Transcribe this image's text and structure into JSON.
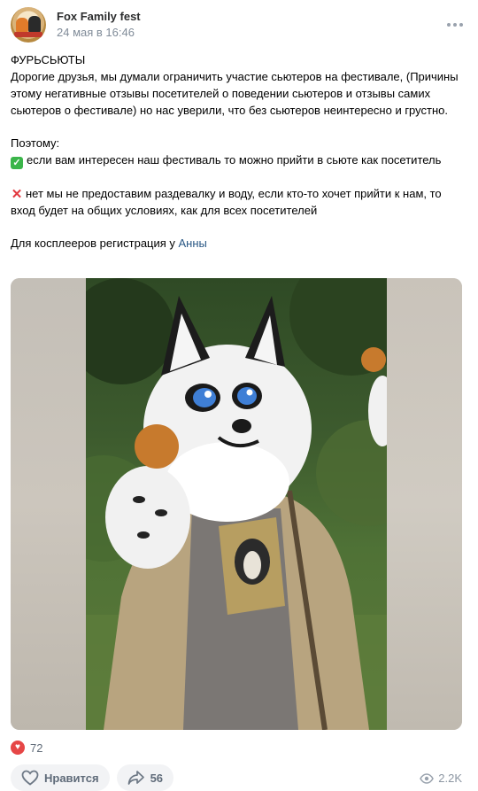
{
  "post": {
    "author": "Fox Family fest",
    "date": "24 мая в 16:46",
    "text": {
      "title": "ФУРЬСЬЮТЫ",
      "para1": "Дорогие друзья, мы думали ограничить участие сьютеров на фестивале, (Причины этому негативные отзывы посетителей о поведении сьютеров и отзывы самих сьютеров о фестивале) но нас уверили, что без сьютеров неинтересно и грустно.",
      "therefore": "Поэтому:",
      "yes_line": "если вам интересен наш фестиваль то можно прийти в сьюте как посетитель",
      "no_line": "нет мы не предоставим раздевалку и воду, если кто-то хочет прийти к нам, то вход будет на общих условиях, как для всех посетителей",
      "cosplay_prefix": "Для косплееров регистрация у ",
      "cosplay_mention": "Анны"
    },
    "reactions_count": "72",
    "like_label": "Нравится",
    "share_count": "56",
    "views": "2.2K"
  },
  "icons": {
    "more": "more-icon",
    "reaction": "heart-icon",
    "like": "heart-outline-icon",
    "share": "share-icon",
    "views": "eye-icon",
    "check": "check-emoji-icon",
    "cross": "cross-emoji-icon"
  },
  "colors": {
    "author": "#2c2d2e",
    "meta": "#818c99",
    "link": "#2a5885",
    "reaction": "#e64646",
    "button_bg": "#f2f3f5"
  }
}
